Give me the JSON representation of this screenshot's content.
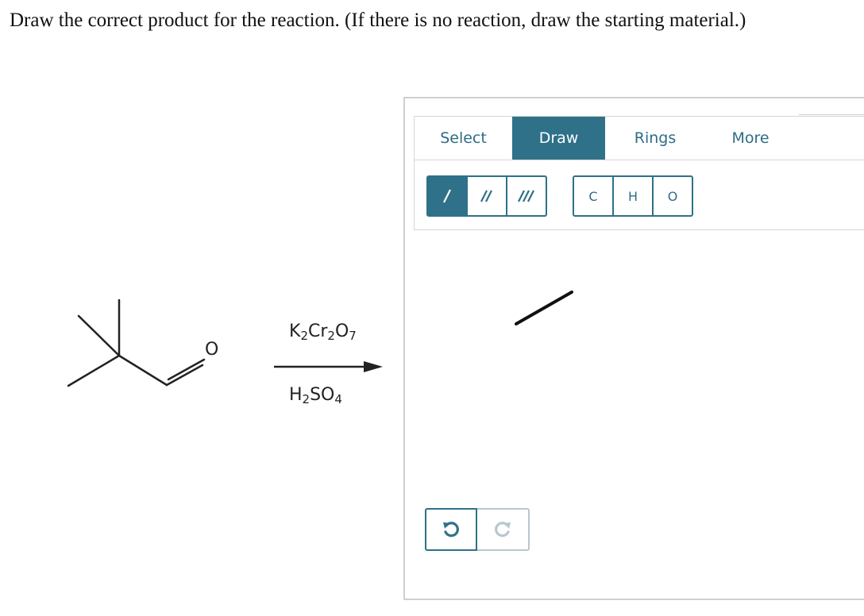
{
  "question": {
    "text": "Draw the correct product for the reaction. (If there is no reaction, draw the starting material.)"
  },
  "reaction": {
    "atom_label": "O",
    "reagent_top": {
      "parts": [
        "K",
        "2",
        "Cr",
        "2",
        "O",
        "7"
      ]
    },
    "reagent_bottom": {
      "parts": [
        "H",
        "2",
        "SO",
        "4"
      ]
    }
  },
  "sketcher": {
    "tabs": [
      {
        "label": "Select",
        "active": false
      },
      {
        "label": "Draw",
        "active": true
      },
      {
        "label": "Rings",
        "active": false
      },
      {
        "label": "More",
        "active": false
      }
    ],
    "bond_tools": [
      {
        "name": "single-bond",
        "active": true
      },
      {
        "name": "double-bond",
        "active": false
      },
      {
        "name": "triple-bond",
        "active": false
      }
    ],
    "atom_tools": [
      {
        "label": "C"
      },
      {
        "label": "H"
      },
      {
        "label": "O"
      }
    ],
    "undo_icon": "undo-icon",
    "redo_icon": "redo-icon",
    "accent_color": "#2e7188",
    "disabled_color": "#b8c7cf"
  }
}
